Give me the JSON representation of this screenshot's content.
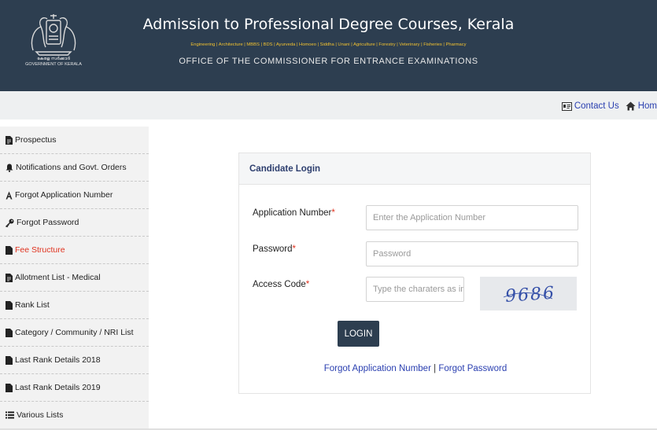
{
  "header": {
    "emblem_line1": "കേരള സർക്കാർ",
    "emblem_line2": "GOVERNMENT OF KERALA",
    "title": "Admission to Professional Degree Courses, Kerala",
    "courses": "Engineering | Architecture | MBBS | BDS | Ayurveda | Homoeo | Siddha | Unani | Agriculture | Forestry | Veterinary | Fisheries | Pharmacy",
    "office": "OFFICE OF THE COMMISSIONER FOR ENTRANCE EXAMINATIONS"
  },
  "toplinks": {
    "contact": "Contact Us",
    "home": "Hom"
  },
  "sidebar": {
    "items": [
      {
        "label": "Prospectus",
        "icon": "document-icon"
      },
      {
        "label": "Notifications and Govt. Orders",
        "icon": "bell-icon"
      },
      {
        "label": "Forgot Application Number",
        "icon": "font-icon"
      },
      {
        "label": "Forgot Password",
        "icon": "key-icon"
      },
      {
        "label": "Fee Structure",
        "icon": "file-icon"
      },
      {
        "label": "Allotment List - Medical",
        "icon": "document-icon"
      },
      {
        "label": "Rank List",
        "icon": "file-icon"
      },
      {
        "label": "Category / Community / NRI List",
        "icon": "file-icon"
      },
      {
        "label": "Last Rank Details 2018",
        "icon": "file-icon"
      },
      {
        "label": "Last Rank Details 2019",
        "icon": "file-icon"
      },
      {
        "label": "Various Lists",
        "icon": "list-icon"
      }
    ],
    "active_index": 4,
    "active_color": "#e0321e"
  },
  "login": {
    "title": "Candidate Login",
    "app_label": "Application Number",
    "app_placeholder": "Enter the Application Number",
    "pwd_label": "Password",
    "pwd_placeholder": "Password",
    "code_label": "Access Code",
    "code_placeholder": "Type the charaters as in image",
    "required_mark": "*",
    "captcha_text": "9686",
    "button": "LOGIN",
    "forgot_app": "Forgot Application Number",
    "separator": "|",
    "forgot_pwd": "Forgot Password"
  },
  "colors": {
    "header_bg": "#2d3e50",
    "link": "#2a3fb0",
    "courses_text": "#f2c230"
  }
}
